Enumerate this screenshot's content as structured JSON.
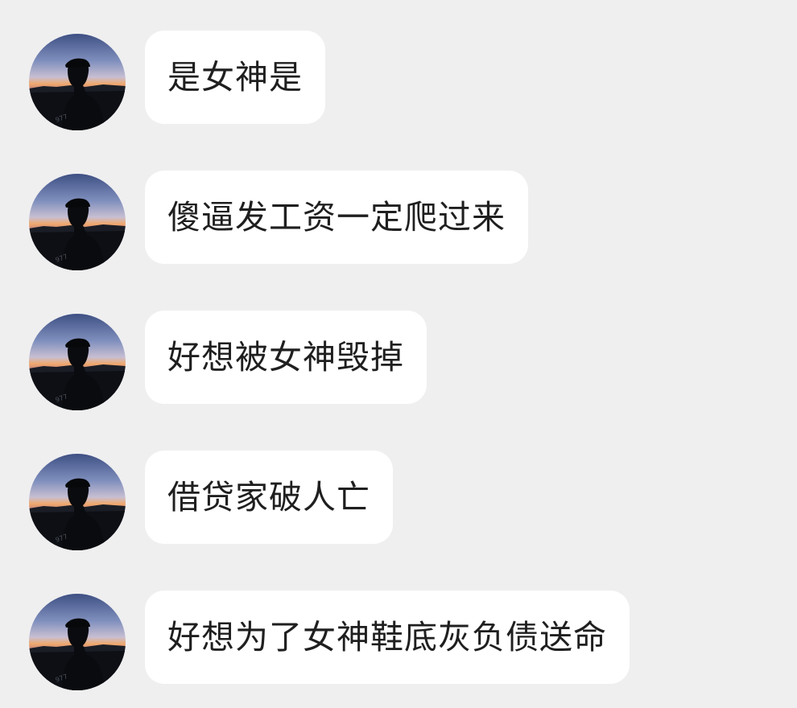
{
  "messages": [
    {
      "text": "是女神是",
      "avatar_icon": "sunset-silhouette-avatar-icon"
    },
    {
      "text": "傻逼发工资一定爬过来",
      "avatar_icon": "sunset-silhouette-avatar-icon"
    },
    {
      "text": "好想被女神毁掉",
      "avatar_icon": "sunset-silhouette-avatar-icon"
    },
    {
      "text": "借贷家破人亡",
      "avatar_icon": "sunset-silhouette-avatar-icon"
    },
    {
      "text": "好想为了女神鞋底灰负债送命",
      "avatar_icon": "sunset-silhouette-avatar-icon"
    }
  ],
  "colors": {
    "background": "#efeff0",
    "bubble": "#ffffff",
    "text": "#1f1f1f"
  }
}
